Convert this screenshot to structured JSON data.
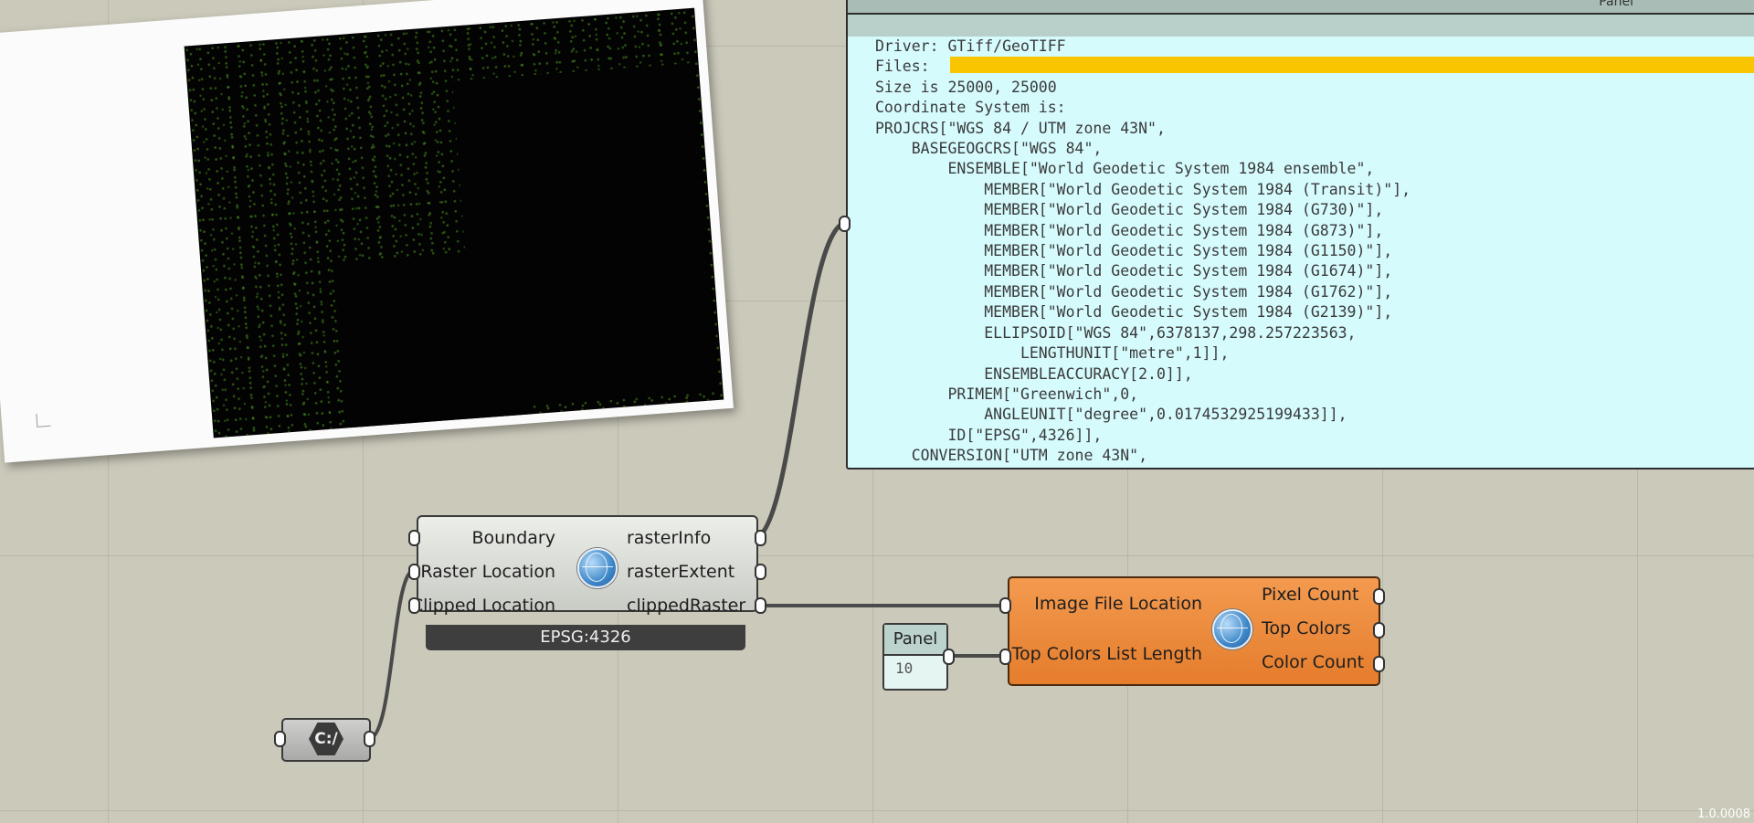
{
  "panel": {
    "header_title": "Panel",
    "lines": [
      "Driver: GTiff/GeoTIFF",
      "Files: ",
      "Size is 25000, 25000",
      "Coordinate System is:",
      "PROJCRS[\"WGS 84 / UTM zone 43N\",",
      "    BASEGEOGCRS[\"WGS 84\",",
      "        ENSEMBLE[\"World Geodetic System 1984 ensemble\",",
      "            MEMBER[\"World Geodetic System 1984 (Transit)\"],",
      "            MEMBER[\"World Geodetic System 1984 (G730)\"],",
      "            MEMBER[\"World Geodetic System 1984 (G873)\"],",
      "            MEMBER[\"World Geodetic System 1984 (G1150)\"],",
      "            MEMBER[\"World Geodetic System 1984 (G1674)\"],",
      "            MEMBER[\"World Geodetic System 1984 (G1762)\"],",
      "            MEMBER[\"World Geodetic System 1984 (G2139)\"],",
      "            ELLIPSOID[\"WGS 84\",6378137,298.257223563,",
      "                LENGTHUNIT[\"metre\",1]],",
      "            ENSEMBLEACCURACY[2.0]],",
      "        PRIMEM[\"Greenwich\",0,",
      "            ANGLEUNIT[\"degree\",0.0174532925199433]],",
      "        ID[\"EPSG\",4326]],",
      "    CONVERSION[\"UTM zone 43N\","
    ]
  },
  "raster_node": {
    "inputs": [
      "Boundary",
      "Raster Location",
      "Clipped Location"
    ],
    "outputs": [
      "rasterInfo",
      "rasterExtent",
      "clippedRaster"
    ],
    "footer": "EPSG:4326",
    "icon": "globe-icon"
  },
  "color_node": {
    "inputs": [
      "Image File Location",
      "Top Colors List Length"
    ],
    "outputs": [
      "Pixel Count",
      "Top Colors",
      "Color Count"
    ],
    "icon": "globe-icon",
    "color": "#ee8a3c"
  },
  "panel_node": {
    "title": "Panel",
    "value": "10"
  },
  "file_node": {
    "icon_label": "C:/"
  },
  "version": "1.0.0008",
  "colors": {
    "canvas": "#cbc9ba",
    "panel_bg": "#d6fbfd",
    "highlight": "#f9c500"
  }
}
